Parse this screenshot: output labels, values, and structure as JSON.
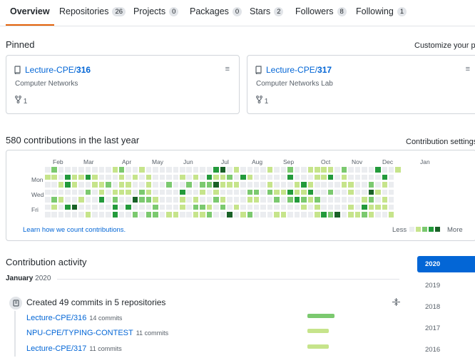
{
  "tabs": [
    {
      "label": "Overview",
      "count": null
    },
    {
      "label": "Repositories",
      "count": "26"
    },
    {
      "label": "Projects",
      "count": "0"
    },
    {
      "label": "Packages",
      "count": "0"
    },
    {
      "label": "Stars",
      "count": "2"
    },
    {
      "label": "Followers",
      "count": "8"
    },
    {
      "label": "Following",
      "count": "1"
    }
  ],
  "pinned": {
    "title": "Pinned",
    "customize": "Customize your pins",
    "cards": [
      {
        "owner": "Lecture-CPE/",
        "name": "316",
        "description": "Computer Networks",
        "forks": "1"
      },
      {
        "owner": "Lecture-CPE/",
        "name": "317",
        "description": "Computer Networks Lab",
        "forks": "1"
      }
    ]
  },
  "contributions": {
    "summary": "580 contributions in the last year",
    "settings": "Contribution settings",
    "months": [
      "Feb",
      "Mar",
      "Apr",
      "May",
      "Jun",
      "Jul",
      "Aug",
      "Sep",
      "Oct",
      "Nov",
      "Dec",
      "Jan"
    ],
    "days": [
      "Mon",
      "Wed",
      "Fri"
    ],
    "learn_link": "Learn how we count contributions.",
    "legend_less": "Less",
    "legend_more": "More",
    "colors": [
      "#ebedf0",
      "#c6e48b",
      "#7bc96f",
      "#239a3b",
      "#196127"
    ]
  },
  "activity": {
    "title": "Contribution activity",
    "month": "January",
    "year": "2020",
    "created": "Created 49 commits in 5 repositories",
    "rows": [
      {
        "repo": "Lecture-CPE/316",
        "commits": "14 commits",
        "fill": 1.0
      },
      {
        "repo": "NPU-CPE/TYPING-CONTEST",
        "commits": "11 commits",
        "fill": 0.8
      },
      {
        "repo": "Lecture-CPE/317",
        "commits": "11 commits",
        "fill": 0.8
      }
    ]
  },
  "years": [
    "2020",
    "2019",
    "2018",
    "2017",
    "2016"
  ],
  "selected_year": "2020"
}
